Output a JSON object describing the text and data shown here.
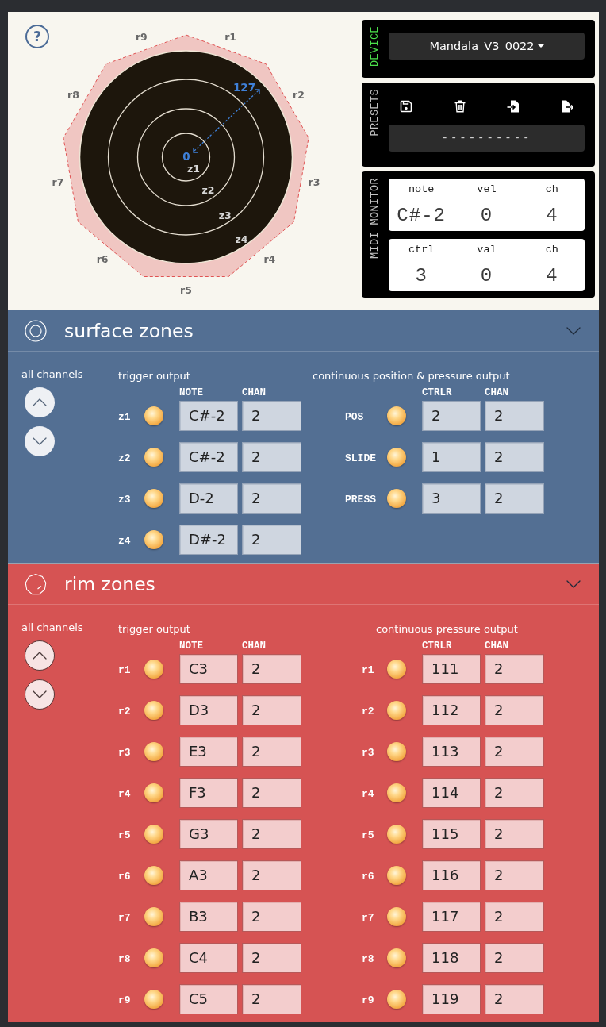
{
  "help_button": {
    "label": "?"
  },
  "pad_diagram": {
    "rim_labels": [
      "r1",
      "r2",
      "r3",
      "r4",
      "r5",
      "r6",
      "r7",
      "r8",
      "r9"
    ],
    "zone_labels": [
      "z1",
      "z2",
      "z3",
      "z4"
    ],
    "range_min": "0",
    "range_max": "127"
  },
  "device_panel": {
    "label": "DEVICE",
    "selected_device": "Mandala_V3_0022"
  },
  "presets_panel": {
    "label": "PRESETS",
    "preset_name": "----------"
  },
  "midi_monitor": {
    "label": "MIDI MONITOR",
    "readouts": [
      {
        "fields": [
          {
            "label": "note",
            "value": "C#-2"
          },
          {
            "label": "vel",
            "value": "0"
          },
          {
            "label": "ch",
            "value": "4"
          }
        ]
      },
      {
        "fields": [
          {
            "label": "ctrl",
            "value": "3"
          },
          {
            "label": "val",
            "value": "0"
          },
          {
            "label": "ch",
            "value": "4"
          }
        ]
      }
    ]
  },
  "sections": [
    {
      "kind": "surface",
      "title": "surface zones",
      "expanded": true,
      "all_channels_label": "all channels",
      "trigger_output": {
        "title": "trigger output",
        "columns": [
          "NOTE",
          "CHAN"
        ],
        "rows": [
          {
            "label": "z1",
            "note": "C#-2",
            "chan": "2"
          },
          {
            "label": "z2",
            "note": "C#-2",
            "chan": "2"
          },
          {
            "label": "z3",
            "note": "D-2",
            "chan": "2"
          },
          {
            "label": "z4",
            "note": "D#-2",
            "chan": "2"
          }
        ]
      },
      "continuous_output": {
        "title": "continuous position & pressure output",
        "columns": [
          "CTRLR",
          "CHAN"
        ],
        "rows": [
          {
            "label": "POS",
            "ctrlr": "2",
            "chan": "2"
          },
          {
            "label": "SLIDE",
            "ctrlr": "1",
            "chan": "2"
          },
          {
            "label": "PRESS",
            "ctrlr": "3",
            "chan": "2"
          }
        ]
      }
    },
    {
      "kind": "rim",
      "title": "rim zones",
      "expanded": true,
      "all_channels_label": "all channels",
      "trigger_output": {
        "title": "trigger output",
        "columns": [
          "NOTE",
          "CHAN"
        ],
        "rows": [
          {
            "label": "r1",
            "note": "C3",
            "chan": "2"
          },
          {
            "label": "r2",
            "note": "D3",
            "chan": "2"
          },
          {
            "label": "r3",
            "note": "E3",
            "chan": "2"
          },
          {
            "label": "r4",
            "note": "F3",
            "chan": "2"
          },
          {
            "label": "r5",
            "note": "G3",
            "chan": "2"
          },
          {
            "label": "r6",
            "note": "A3",
            "chan": "2"
          },
          {
            "label": "r7",
            "note": "B3",
            "chan": "2"
          },
          {
            "label": "r8",
            "note": "C4",
            "chan": "2"
          },
          {
            "label": "r9",
            "note": "C5",
            "chan": "2"
          }
        ]
      },
      "continuous_output": {
        "title": "continuous pressure output",
        "columns": [
          "CTRLR",
          "CHAN"
        ],
        "rows": [
          {
            "label": "r1",
            "ctrlr": "111",
            "chan": "2"
          },
          {
            "label": "r2",
            "ctrlr": "112",
            "chan": "2"
          },
          {
            "label": "r3",
            "ctrlr": "113",
            "chan": "2"
          },
          {
            "label": "r4",
            "ctrlr": "114",
            "chan": "2"
          },
          {
            "label": "r5",
            "ctrlr": "115",
            "chan": "2"
          },
          {
            "label": "r6",
            "ctrlr": "116",
            "chan": "2"
          },
          {
            "label": "r7",
            "ctrlr": "117",
            "chan": "2"
          },
          {
            "label": "r8",
            "ctrlr": "118",
            "chan": "2"
          },
          {
            "label": "r9",
            "ctrlr": "119",
            "chan": "2"
          }
        ]
      }
    }
  ]
}
